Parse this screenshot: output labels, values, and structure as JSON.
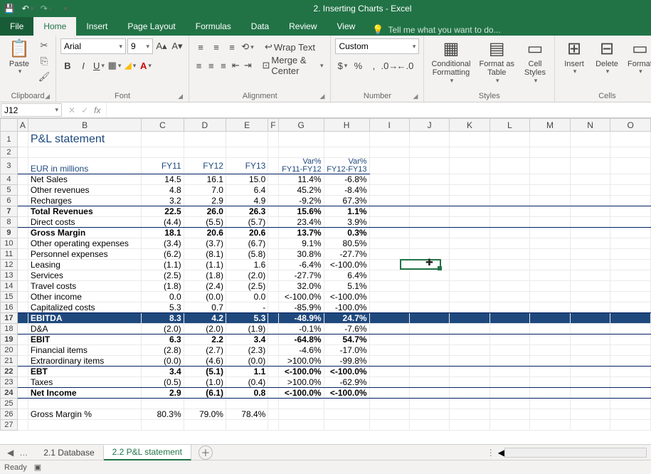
{
  "title": "2. Inserting Charts - Excel",
  "tabs": {
    "file": "File",
    "home": "Home",
    "insert": "Insert",
    "page_layout": "Page Layout",
    "formulas": "Formulas",
    "data": "Data",
    "review": "Review",
    "view": "View",
    "tell_me": "Tell me what you want to do..."
  },
  "ribbon": {
    "paste": "Paste",
    "clipboard": "Clipboard",
    "font_name": "Arial",
    "font_size": "9",
    "font_group": "Font",
    "wrap": "Wrap Text",
    "merge": "Merge & Center",
    "alignment": "Alignment",
    "num_format": "Custom",
    "number": "Number",
    "cond_fmt": "Conditional\nFormatting",
    "fmt_table": "Format as\nTable",
    "cell_styles": "Cell\nStyles",
    "styles": "Styles",
    "insert_btn": "Insert",
    "delete_btn": "Delete",
    "format_btn": "Format",
    "cells": "Cells"
  },
  "name_box": "J12",
  "status": "Ready",
  "sheet_tabs": {
    "db": "2.1 Database",
    "pl": "2.2 P&L statement"
  },
  "report": {
    "title": "P&L statement",
    "unit": "EUR in millions",
    "cols": [
      "FY11",
      "FY12",
      "FY13"
    ],
    "var_hdr": "Var%",
    "var_cols": [
      "FY11-FY12",
      "FY12-FY13"
    ],
    "rows": [
      {
        "t": "r",
        "label": "Net Sales",
        "v": [
          "14.5",
          "16.1",
          "15.0"
        ],
        "p": [
          "11.4%",
          "-6.8%"
        ]
      },
      {
        "t": "r",
        "label": "Other revenues",
        "v": [
          "4.8",
          "7.0",
          "6.4"
        ],
        "p": [
          "45.2%",
          "-8.4%"
        ]
      },
      {
        "t": "ru",
        "label": "Recharges",
        "v": [
          "3.2",
          "2.9",
          "4.9"
        ],
        "p": [
          "-9.2%",
          "67.3%"
        ]
      },
      {
        "t": "b",
        "label": "Total Revenues",
        "v": [
          "22.5",
          "26.0",
          "26.3"
        ],
        "p": [
          "15.6%",
          "1.1%"
        ]
      },
      {
        "t": "ru",
        "label": "Direct costs",
        "v": [
          "(4.4)",
          "(5.5)",
          "(5.7)"
        ],
        "p": [
          "23.4%",
          "3.9%"
        ]
      },
      {
        "t": "b",
        "label": "Gross Margin",
        "v": [
          "18.1",
          "20.6",
          "20.6"
        ],
        "p": [
          "13.7%",
          "0.3%"
        ]
      },
      {
        "t": "r",
        "label": "Other operating expenses",
        "v": [
          "(3.4)",
          "(3.7)",
          "(6.7)"
        ],
        "p": [
          "9.1%",
          "80.5%"
        ]
      },
      {
        "t": "r",
        "label": "Personnel expenses",
        "v": [
          "(6.2)",
          "(8.1)",
          "(5.8)"
        ],
        "p": [
          "30.8%",
          "-27.7%"
        ]
      },
      {
        "t": "r",
        "label": "Leasing",
        "v": [
          "(1.1)",
          "(1.1)",
          "1.6"
        ],
        "p": [
          "-6.4%",
          "<-100.0%"
        ]
      },
      {
        "t": "r",
        "label": "Services",
        "v": [
          "(2.5)",
          "(1.8)",
          "(2.0)"
        ],
        "p": [
          "-27.7%",
          "6.4%"
        ]
      },
      {
        "t": "r",
        "label": "Travel costs",
        "v": [
          "(1.8)",
          "(2.4)",
          "(2.5)"
        ],
        "p": [
          "32.0%",
          "5.1%"
        ]
      },
      {
        "t": "r",
        "label": "Other income",
        "v": [
          "0.0",
          "(0.0)",
          "0.0"
        ],
        "p": [
          "<-100.0%",
          "<-100.0%"
        ]
      },
      {
        "t": "ru",
        "label": "Capitalized costs",
        "v": [
          "5.3",
          "0.7",
          "-"
        ],
        "p": [
          "-85.9%",
          "-100.0%"
        ]
      },
      {
        "t": "hi",
        "label": "EBITDA",
        "v": [
          "8.3",
          "4.2",
          "5.3"
        ],
        "p": [
          "-48.9%",
          "24.7%"
        ]
      },
      {
        "t": "ru",
        "label": "D&A",
        "v": [
          "(2.0)",
          "(2.0)",
          "(1.9)"
        ],
        "p": [
          "-0.1%",
          "-7.6%"
        ]
      },
      {
        "t": "b",
        "label": "EBIT",
        "v": [
          "6.3",
          "2.2",
          "3.4"
        ],
        "p": [
          "-64.8%",
          "54.7%"
        ]
      },
      {
        "t": "r",
        "label": "Financial items",
        "v": [
          "(2.8)",
          "(2.7)",
          "(2.3)"
        ],
        "p": [
          "-4.6%",
          "-17.0%"
        ]
      },
      {
        "t": "ru",
        "label": "Extraordinary items",
        "v": [
          "(0.0)",
          "(4.6)",
          "(0.0)"
        ],
        "p": [
          ">100.0%",
          "-99.8%"
        ]
      },
      {
        "t": "b",
        "label": "EBT",
        "v": [
          "3.4",
          "(5.1)",
          "1.1"
        ],
        "p": [
          "<-100.0%",
          "<-100.0%"
        ]
      },
      {
        "t": "ru",
        "label": "Taxes",
        "v": [
          "(0.5)",
          "(1.0)",
          "(0.4)"
        ],
        "p": [
          ">100.0%",
          "-62.9%"
        ]
      },
      {
        "t": "bu",
        "label": "Net Income",
        "v": [
          "2.9",
          "(6.1)",
          "0.8"
        ],
        "p": [
          "<-100.0%",
          "<-100.0%"
        ]
      },
      {
        "t": "sp"
      },
      {
        "t": "r",
        "label": "Gross Margin %",
        "v": [
          "80.3%",
          "79.0%",
          "78.4%"
        ],
        "p": [
          "",
          ""
        ]
      }
    ]
  }
}
